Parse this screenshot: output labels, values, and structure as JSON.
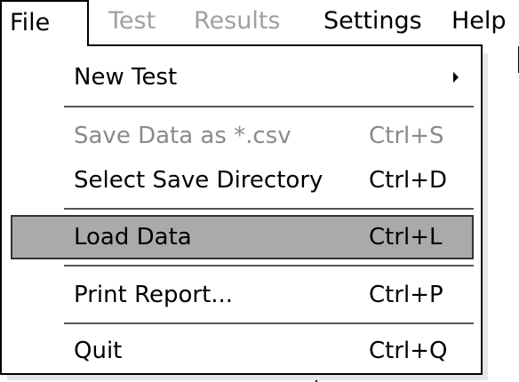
{
  "menubar": {
    "items": [
      {
        "label": "File",
        "state": "open"
      },
      {
        "label": "Test",
        "state": "disabled"
      },
      {
        "label": "Results",
        "state": "disabled"
      },
      {
        "label": "Settings",
        "state": "enabled"
      },
      {
        "label": "Help",
        "state": "enabled"
      }
    ]
  },
  "file_menu": {
    "items": [
      {
        "label": "New Test",
        "shortcut": "",
        "icon": "submenu-arrow-icon"
      },
      {
        "label": "Save Data as *.csv",
        "shortcut": "Ctrl+S",
        "state": "disabled"
      },
      {
        "label": "Select Save Directory",
        "shortcut": "Ctrl+D"
      },
      {
        "label": "Load Data",
        "shortcut": "Ctrl+L",
        "state": "highlighted"
      },
      {
        "label": "Print Report...",
        "shortcut": "Ctrl+P"
      },
      {
        "label": "Quit",
        "shortcut": "Ctrl+Q"
      }
    ]
  },
  "colors": {
    "highlight": "#aaaaaa",
    "disabled_text": "#a0a0a0",
    "border": "#000000"
  }
}
